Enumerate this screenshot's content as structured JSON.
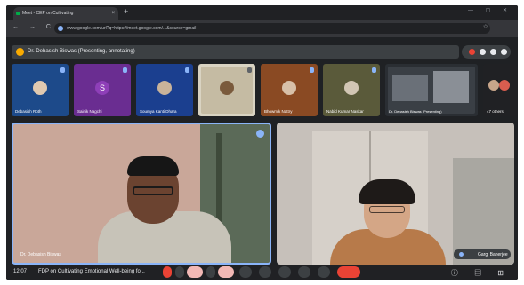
{
  "browser": {
    "tab_title": "Meet - CEP on Cultivating",
    "tab_close": "×",
    "new_tab": "+",
    "url": "www.google.com/url?q=https://meet.google.com/...&source=gmail",
    "nav": "← → C",
    "window_controls": "— ▢ ✕",
    "menu_icons": "☆ ⋮"
  },
  "meet": {
    "presenting_label": "Dr. Debasish Biswas (Presenting, annotating)",
    "participants": [
      {
        "name": "Debasish Roth",
        "initial": "",
        "bg": "#1d4a8a"
      },
      {
        "name": "Sainik Nagchi",
        "initial": "S",
        "bg": "#6a2d91"
      },
      {
        "name": "Soumya Kanti Dhara",
        "initial": "",
        "bg": "#1b3f8f"
      },
      {
        "name": "",
        "initial": "",
        "bg": "#d9d3c2"
      },
      {
        "name": "Bhowmik Nattry",
        "initial": "",
        "bg": "#8a4a23"
      },
      {
        "name": "Nabid Kumar Naskar",
        "initial": "",
        "bg": "#5a5a3a"
      },
      {
        "name": "Dr. Debasish Biswas (Presenting)",
        "initial": "",
        "bg": "#2a2e33"
      },
      {
        "name": "47 others",
        "initial": "",
        "bg": "#202124"
      }
    ],
    "main_left_name": "Dr. Debasish Biswas",
    "main_right_name": "Gargi Banerjee",
    "meeting_time": "12:07",
    "meeting_title": "FDP on Cultivating Emotional Well-being fo...",
    "right_icons": "ⓘ ▤ ⊞"
  }
}
